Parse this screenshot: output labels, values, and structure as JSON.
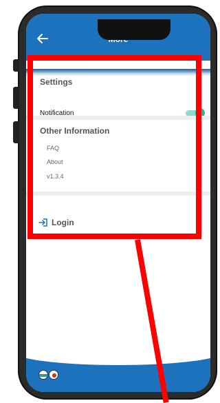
{
  "appbar": {
    "title": "More"
  },
  "settings": {
    "title": "Settings",
    "notification_label": "Notification",
    "notification_on": true
  },
  "other_info": {
    "title": "Other Information",
    "items": [
      "FAQ",
      "About",
      "v1.3.4"
    ]
  },
  "login": {
    "label": "Login"
  },
  "colors": {
    "brand_blue": "#1d72be",
    "toggle_on": "#1fb89a",
    "highlight": "#ff0000"
  }
}
